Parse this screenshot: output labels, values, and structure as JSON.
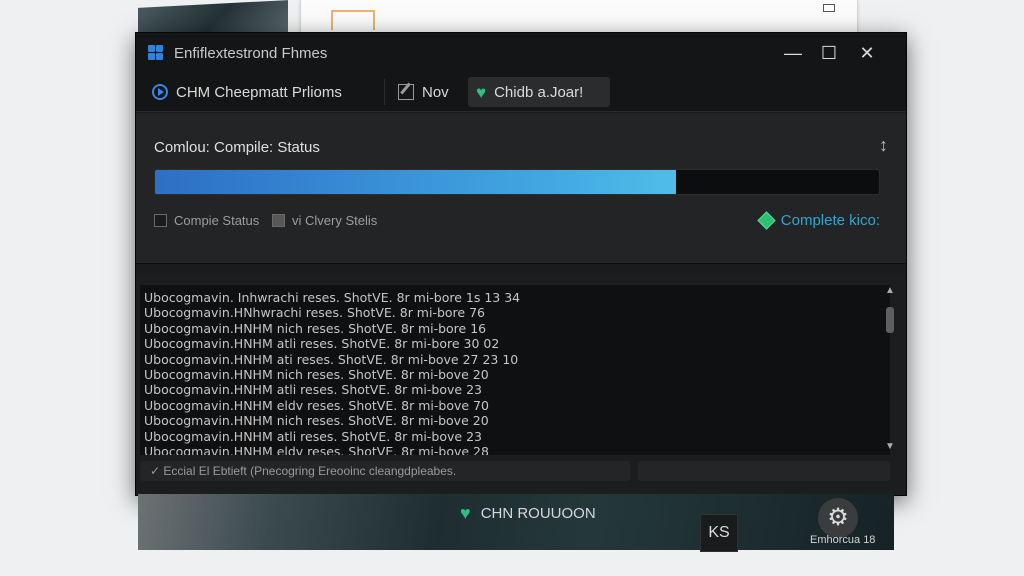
{
  "window": {
    "title": "Enfiflextestrond Fhmes",
    "controls": {
      "minimize": "—",
      "maximize": "☐",
      "close": "✕"
    }
  },
  "toolbar": {
    "items": [
      {
        "label": "CHM Cheepmatt Prlioms",
        "icon": "play-circle-icon"
      },
      {
        "label": "Nov",
        "icon": "edit-icon"
      },
      {
        "label": "Chidb a.Joar!",
        "icon": "heart-icon",
        "active": true
      }
    ]
  },
  "status": {
    "heading": "Comlou: Compile: Status",
    "progress_fraction": 0.72,
    "checkboxes": [
      {
        "label": "Compie Status"
      },
      {
        "label": "vi Clvery Stelis"
      }
    ],
    "complete_label": "Complete kico:"
  },
  "log": {
    "lines": [
      "Ubocogmavin. Inhwrachi reses. ShotVE. 8r mi-bore 1s 13 34",
      "Ubocogmavin.HNhwrachi reses. ShotVE. 8r mi-bore 76",
      "Ubocogmavin.HNHM nich reses. ShotVE. 8r mi-bore 16",
      "Ubocogmavin.HNHM atli reses. ShotVE. 8r mi-bore 30 02",
      "Ubocogmavin.HNHM ati reses. ShotVE. 8r mi-bove 27 23 10",
      "Ubocogmavin.HNHM nich reses. ShotVE. 8r mi-bove 20",
      "Ubocogmavin.HNHM atli reses. ShotVE. 8r mi-bove 23",
      "Ubocogmavin.HNHM eldv reses. ShotVE. 8r mi-bove 70",
      "Ubocogmavin.HNHM nich reses. ShotVE. 8r mi-bove 20",
      "Ubocogmavin.HNHM atli reses. ShotVE. 8r mi-bove 23",
      "Ubocogmavin.HNHM eldv reses. ShotVE. 8r mi-bove 28"
    ],
    "status_line": "✓ Eccial El Ebtieft (Pnecogring Ereooinc cleangdpleabes."
  },
  "bottom": {
    "button_label": "CHN ROUUOON",
    "ks_label": "KS",
    "gear_label": "Emhorcua 18"
  },
  "colors": {
    "accent_blue": "#40a3e0",
    "accent_green": "#2fbf80",
    "complete_text": "#2fa7d3"
  }
}
